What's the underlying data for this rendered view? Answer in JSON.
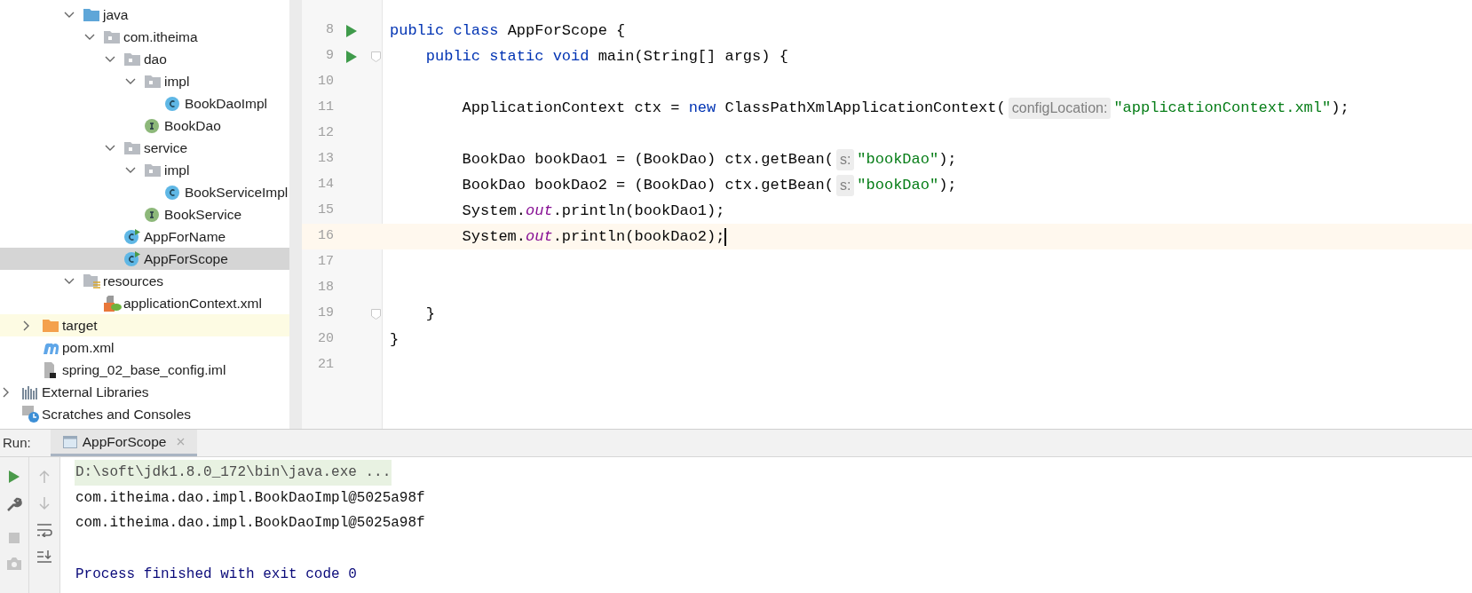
{
  "project_tree": {
    "main_folders": [
      {
        "label": "java",
        "kind": "source-folder",
        "expanded": true,
        "selected": false,
        "hovered": false,
        "children": [
          {
            "label": "com.itheima",
            "kind": "package",
            "expanded": true,
            "selected": false,
            "hovered": false,
            "children": [
              {
                "label": "dao",
                "kind": "package",
                "expanded": true,
                "selected": false,
                "hovered": false,
                "children": [
                  {
                    "label": "impl",
                    "kind": "package",
                    "expanded": true,
                    "selected": false,
                    "hovered": false,
                    "children": [
                      {
                        "label": "BookDaoImpl",
                        "kind": "class",
                        "selected": false,
                        "hovered": false
                      }
                    ]
                  },
                  {
                    "label": "BookDao",
                    "kind": "interface",
                    "selected": false,
                    "hovered": false
                  }
                ]
              },
              {
                "label": "service",
                "kind": "package",
                "expanded": true,
                "selected": false,
                "hovered": false,
                "children": [
                  {
                    "label": "impl",
                    "kind": "package",
                    "expanded": true,
                    "selected": false,
                    "hovered": false,
                    "children": [
                      {
                        "label": "BookServiceImpl",
                        "kind": "class",
                        "selected": false,
                        "hovered": false
                      }
                    ]
                  },
                  {
                    "label": "BookService",
                    "kind": "interface",
                    "selected": false,
                    "hovered": false
                  }
                ]
              },
              {
                "label": "AppForName",
                "kind": "runnable-class",
                "selected": false,
                "hovered": false
              },
              {
                "label": "AppForScope",
                "kind": "runnable-class",
                "selected": true,
                "hovered": false
              }
            ]
          }
        ]
      },
      {
        "label": "resources",
        "kind": "resource-folder",
        "expanded": true,
        "selected": false,
        "hovered": false,
        "children": [
          {
            "label": "applicationContext.xml",
            "kind": "spring-xml",
            "selected": false,
            "hovered": false
          }
        ]
      }
    ],
    "module_items": [
      {
        "label": "target",
        "kind": "excluded-folder",
        "expanded": false,
        "selected": false,
        "hovered": true
      },
      {
        "label": "pom.xml",
        "kind": "maven",
        "selected": false,
        "hovered": false
      },
      {
        "label": "spring_02_base_config.iml",
        "kind": "iml",
        "selected": false,
        "hovered": false
      }
    ],
    "roots": [
      {
        "label": "External Libraries",
        "kind": "libraries",
        "expanded": false,
        "selected": false,
        "hovered": false
      },
      {
        "label": "Scratches and Consoles",
        "kind": "scratches",
        "selected": false,
        "hovered": false
      }
    ]
  },
  "editor": {
    "lines": [
      {
        "number": "8",
        "run_marker": true,
        "fold": false,
        "current": false,
        "caret": false,
        "tokens": [
          {
            "kind": "keyword",
            "text": "public class "
          },
          {
            "kind": "plain",
            "text": "AppForScope {"
          }
        ]
      },
      {
        "number": "9",
        "run_marker": true,
        "fold": true,
        "current": false,
        "caret": false,
        "tokens": [
          {
            "kind": "keyword",
            "text": "    public static void "
          },
          {
            "kind": "plain",
            "text": "main(String[] args) {"
          }
        ]
      },
      {
        "number": "10",
        "run_marker": false,
        "fold": false,
        "current": false,
        "caret": false
      },
      {
        "number": "11",
        "run_marker": false,
        "fold": false,
        "current": false,
        "caret": false,
        "tokens": [
          {
            "kind": "plain",
            "text": "        ApplicationContext ctx = "
          },
          {
            "kind": "keyword",
            "text": "new "
          },
          {
            "kind": "plain",
            "text": "ClassPathXmlApplicationContext("
          },
          {
            "kind": "hint",
            "text": "configLocation:"
          },
          {
            "kind": "string",
            "text": "\"applicationContext.xml\""
          },
          {
            "kind": "plain",
            "text": ");"
          }
        ]
      },
      {
        "number": "12",
        "run_marker": false,
        "fold": false,
        "current": false,
        "caret": false
      },
      {
        "number": "13",
        "run_marker": false,
        "fold": false,
        "current": false,
        "caret": false,
        "tokens": [
          {
            "kind": "plain",
            "text": "        BookDao bookDao1 = (BookDao) ctx.getBean("
          },
          {
            "kind": "hint",
            "text": "s:"
          },
          {
            "kind": "string",
            "text": "\"bookDao\""
          },
          {
            "kind": "plain",
            "text": ");"
          }
        ]
      },
      {
        "number": "14",
        "run_marker": false,
        "fold": false,
        "current": false,
        "caret": false,
        "tokens": [
          {
            "kind": "plain",
            "text": "        BookDao bookDao2 = (BookDao) ctx.getBean("
          },
          {
            "kind": "hint",
            "text": "s:"
          },
          {
            "kind": "string",
            "text": "\"bookDao\""
          },
          {
            "kind": "plain",
            "text": ");"
          }
        ]
      },
      {
        "number": "15",
        "run_marker": false,
        "fold": false,
        "current": false,
        "caret": false,
        "tokens": [
          {
            "kind": "plain",
            "text": "        System."
          },
          {
            "kind": "static-field",
            "text": "out"
          },
          {
            "kind": "plain",
            "text": ".println(bookDao1);"
          }
        ]
      },
      {
        "number": "16",
        "run_marker": false,
        "fold": false,
        "current": true,
        "caret": true,
        "tokens": [
          {
            "kind": "plain",
            "text": "        System."
          },
          {
            "kind": "static-field",
            "text": "out"
          },
          {
            "kind": "plain",
            "text": ".println(bookDao2);"
          }
        ]
      },
      {
        "number": "17",
        "run_marker": false,
        "fold": false,
        "current": false,
        "caret": false
      },
      {
        "number": "18",
        "run_marker": false,
        "fold": false,
        "current": false,
        "caret": false
      },
      {
        "number": "19",
        "run_marker": false,
        "fold": true,
        "current": false,
        "caret": false,
        "tokens": [
          {
            "kind": "plain",
            "text": "    }"
          }
        ]
      },
      {
        "number": "20",
        "run_marker": false,
        "fold": false,
        "current": false,
        "caret": false,
        "tokens": [
          {
            "kind": "plain",
            "text": "}"
          }
        ]
      },
      {
        "number": "21",
        "run_marker": false,
        "fold": false,
        "current": false,
        "caret": false
      }
    ]
  },
  "run_panel": {
    "label": "Run:",
    "tabs": [
      {
        "label": "AppForScope",
        "selected": true
      }
    ],
    "console": [
      {
        "kind": "command",
        "text": "D:\\soft\\jdk1.8.0_172\\bin\\java.exe ..."
      },
      {
        "kind": "output",
        "text": "com.itheima.dao.impl.BookDaoImpl@5025a98f"
      },
      {
        "kind": "output",
        "text": "com.itheima.dao.impl.BookDaoImpl@5025a98f"
      },
      {
        "kind": "exit",
        "text": "Process finished with exit code 0"
      }
    ]
  }
}
